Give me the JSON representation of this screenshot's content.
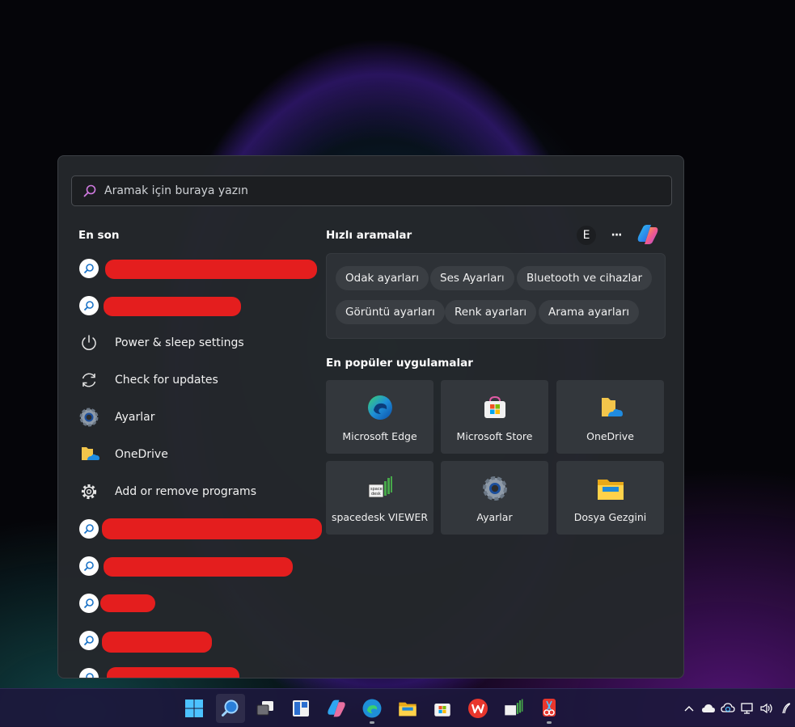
{
  "search": {
    "placeholder": "Aramak için buraya yazın"
  },
  "recent": {
    "title": "En son",
    "items": [
      {
        "label": "",
        "icon": "search-icon",
        "redacted": true
      },
      {
        "label": "",
        "icon": "search-icon",
        "redacted": true
      },
      {
        "label": "Power & sleep settings",
        "icon": "power-icon"
      },
      {
        "label": "Check for updates",
        "icon": "refresh-icon"
      },
      {
        "label": "Ayarlar",
        "icon": "settings-app-icon"
      },
      {
        "label": "OneDrive",
        "icon": "onedrive-icon"
      },
      {
        "label": "Add or remove programs",
        "icon": "gear-icon"
      },
      {
        "label": "",
        "icon": "search-icon",
        "redacted": true
      },
      {
        "label": "",
        "icon": "search-icon",
        "redacted": true
      },
      {
        "label": "",
        "icon": "search-icon",
        "redacted": true
      },
      {
        "label": "",
        "icon": "search-icon",
        "redacted": true
      },
      {
        "label": "",
        "icon": "search-icon",
        "redacted": true
      }
    ]
  },
  "quick": {
    "title": "Hızlı aramalar",
    "avatar_letter": "E",
    "more_label": "···",
    "chips": [
      "Odak ayarları",
      "Ses Ayarları",
      "Bluetooth ve cihazlar",
      "Görüntü ayarları",
      "Renk ayarları",
      "Arama ayarları"
    ]
  },
  "popular": {
    "title": "En popüler uygulamalar",
    "apps": [
      {
        "label": "Microsoft Edge",
        "icon": "edge-icon"
      },
      {
        "label": "Microsoft Store",
        "icon": "store-icon"
      },
      {
        "label": "OneDrive",
        "icon": "onedrive-folder-icon"
      },
      {
        "label": "spacedesk VIEWER",
        "icon": "spacedesk-icon"
      },
      {
        "label": "Ayarlar",
        "icon": "settings-app-icon"
      },
      {
        "label": "Dosya Gezgini",
        "icon": "file-explorer-icon"
      }
    ]
  },
  "taskbar": {
    "icons": [
      "windows-start-icon",
      "search-icon",
      "task-view-icon",
      "widgets-icon",
      "copilot-icon",
      "edge-icon",
      "file-explorer-icon",
      "store-icon",
      "wps-icon",
      "spacedesk-icon",
      "snipping-tool-icon"
    ],
    "tray": [
      "chevron-up-icon",
      "cloud-icon",
      "onedrive-sync-icon",
      "network-icon",
      "volume-icon",
      "pen-icon"
    ]
  },
  "colors": {
    "panel": "#24282c",
    "chip": "#3a3e43",
    "tile": "#33373c",
    "redaction": "#e41e1e"
  }
}
